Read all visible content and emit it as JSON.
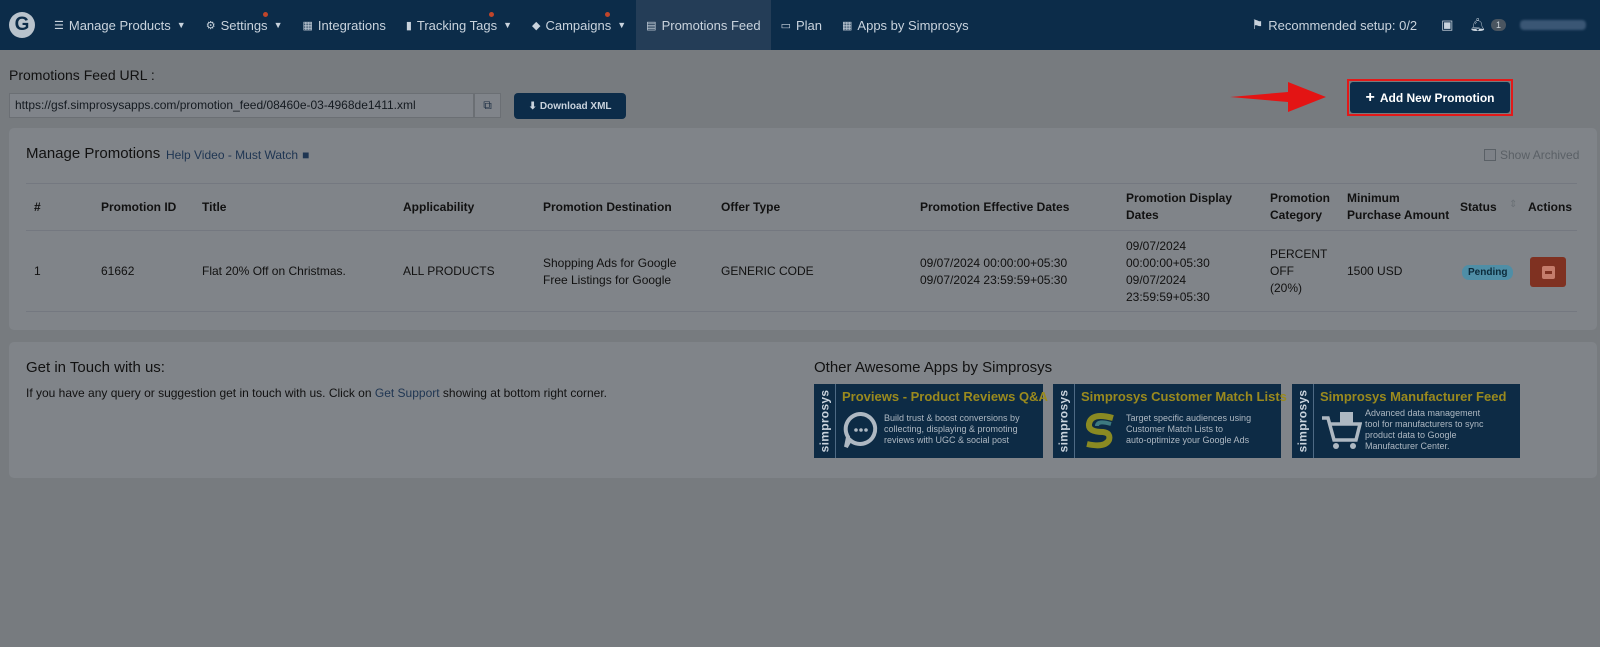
{
  "nav": {
    "logo": "G",
    "items": [
      {
        "label": "Manage Products",
        "icon": "list-icon",
        "caret": true,
        "dot": false
      },
      {
        "label": "Settings",
        "icon": "gear-icon",
        "caret": true,
        "dot": true
      },
      {
        "label": "Integrations",
        "icon": "briefcase-icon",
        "caret": false,
        "dot": false
      },
      {
        "label": "Tracking Tags",
        "icon": "bar-chart-icon",
        "caret": true,
        "dot": true
      },
      {
        "label": "Campaigns",
        "icon": "tag-icon",
        "caret": true,
        "dot": true
      },
      {
        "label": "Promotions Feed",
        "icon": "document-icon",
        "caret": false,
        "dot": false,
        "active": true
      },
      {
        "label": "Plan",
        "icon": "credit-card-icon",
        "caret": false,
        "dot": false
      },
      {
        "label": "Apps by Simprosys",
        "icon": "grid-icon",
        "caret": false,
        "dot": false
      }
    ],
    "recommended": "Recommended setup: 0/2",
    "notification_count": "1"
  },
  "feed": {
    "label": "Promotions Feed URL :",
    "url": "https://gsf.simprosysapps.com/promotion_feed/08460e-03-4968de1411.xml",
    "download_label": "Download XML"
  },
  "add_button_label": "Add New Promotion",
  "manage": {
    "title": "Manage Promotions",
    "help_link": "Help Video - Must Watch",
    "show_archived": "Show Archived",
    "columns": [
      "#",
      "Promotion ID",
      "Title",
      "Applicability",
      "Promotion Destination",
      "Offer Type",
      "Promotion Effective Dates",
      "Promotion Display",
      "Dates",
      "Promotion",
      "Category",
      "Minimum",
      "Purchase Amount",
      "Status",
      "Actions"
    ],
    "rows": [
      {
        "num": "1",
        "promotion_id": "61662",
        "title": "Flat 20% Off on Christmas.",
        "applicability": "ALL PRODUCTS",
        "destination_1": "Shopping Ads for Google",
        "destination_2": "Free Listings for Google",
        "offer_type": "GENERIC CODE",
        "effective_start": "09/07/2024 00:00:00+05:30",
        "effective_end": "09/07/2024 23:59:59+05:30",
        "display_1": "09/07/2024",
        "display_2": "00:00:00+05:30",
        "display_3": "09/07/2024",
        "display_4": "23:59:59+05:30",
        "category_1": "PERCENT",
        "category_2": "OFF",
        "category_3": "(20%)",
        "min_purchase": "1500 USD",
        "status": "Pending"
      }
    ]
  },
  "contact": {
    "title": "Get in Touch with us:",
    "text_before": "If you have any query or suggestion get in touch with us. Click on ",
    "link": "Get Support",
    "text_after": " showing at bottom right corner."
  },
  "other_apps": {
    "title": "Other Awesome Apps by Simprosys",
    "side_label": "simprosys",
    "apps": [
      {
        "title": "Proviews - Product Reviews Q&A",
        "desc": [
          "Build trust & boost conversions by",
          "collecting, displaying & promoting",
          "reviews with UGC & social post"
        ]
      },
      {
        "title": "Simprosys Customer Match Lists",
        "desc": [
          "Target specific audiences using",
          "Customer Match Lists to",
          "auto-optimize your Google Ads"
        ]
      },
      {
        "title": "Simprosys Manufacturer Feed",
        "desc": [
          "Advanced data management",
          "tool for manufacturers to sync",
          "product data to Google",
          "Manufacturer Center."
        ]
      }
    ]
  }
}
